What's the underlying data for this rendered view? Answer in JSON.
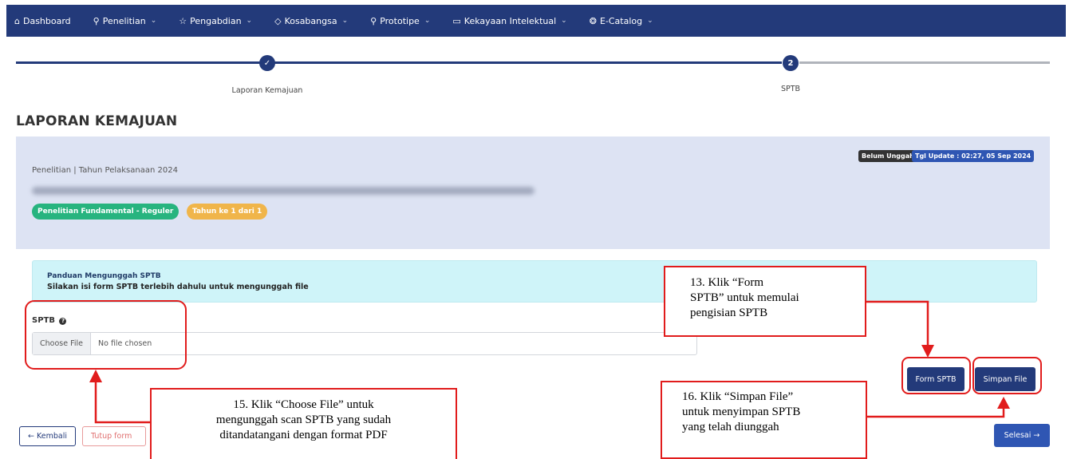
{
  "navbar": {
    "items": [
      {
        "label": "Dashboard",
        "icon": "home-icon",
        "dropdown": false
      },
      {
        "label": "Penelitian",
        "icon": "search-icon",
        "dropdown": true
      },
      {
        "label": "Pengabdian",
        "icon": "star-icon",
        "dropdown": true
      },
      {
        "label": "Kosabangsa",
        "icon": "diamond-icon",
        "dropdown": true
      },
      {
        "label": "Prototipe",
        "icon": "search-icon",
        "dropdown": true
      },
      {
        "label": "Kekayaan Intelektual",
        "icon": "archive-icon",
        "dropdown": true
      },
      {
        "label": "E-Catalog",
        "icon": "badge-icon",
        "dropdown": true
      }
    ]
  },
  "stepper": {
    "steps": [
      {
        "label": "Laporan Kemajuan",
        "marker": "✓",
        "status": "completed"
      },
      {
        "label": "SPTB",
        "marker": "2",
        "status": "active"
      }
    ]
  },
  "page": {
    "title": "LAPORAN KEMAJUAN"
  },
  "info_card": {
    "status_badge": "Belum Unggah",
    "update_badge": "Tgl Update : 02:27, 05 Sep 2024",
    "subtitle": "Penelitian | Tahun Pelaksanaan 2024",
    "scheme_pill": "Penelitian Fundamental - Reguler",
    "year_pill": "Tahun ke 1 dari 1"
  },
  "guide": {
    "title": "Panduan Mengunggah SPTB",
    "text": "Silakan isi form SPTB terlebih dahulu untuk mengunggah file"
  },
  "upload": {
    "label": "SPTB",
    "choose_button": "Choose File",
    "file_status": "No file chosen"
  },
  "actions": {
    "form_button": "Form SPTB",
    "save_button": "Simpan File",
    "back_button": "← Kembali",
    "close_button": "Tutup form",
    "finish_button": "Selesai →"
  },
  "annotations": {
    "callout_13": [
      "13. Klik “Form",
      "SPTB” untuk memulai",
      "pengisian SPTB"
    ],
    "callout_15": [
      "15. Klik “Choose File” untuk",
      "mengunggah scan SPTB yang sudah",
      "ditandatangani dengan format PDF"
    ],
    "callout_16": [
      "16. Klik “Simpan File”",
      "untuk menyimpan SPTB",
      "yang telah diunggah"
    ]
  },
  "colors": {
    "navbar": "#233a7a",
    "annotation": "#e11c1c",
    "info_card": "#dde3f3",
    "guide_box": "#cff4f9",
    "pill_green": "#27b47f",
    "pill_orange": "#f0b54a"
  }
}
